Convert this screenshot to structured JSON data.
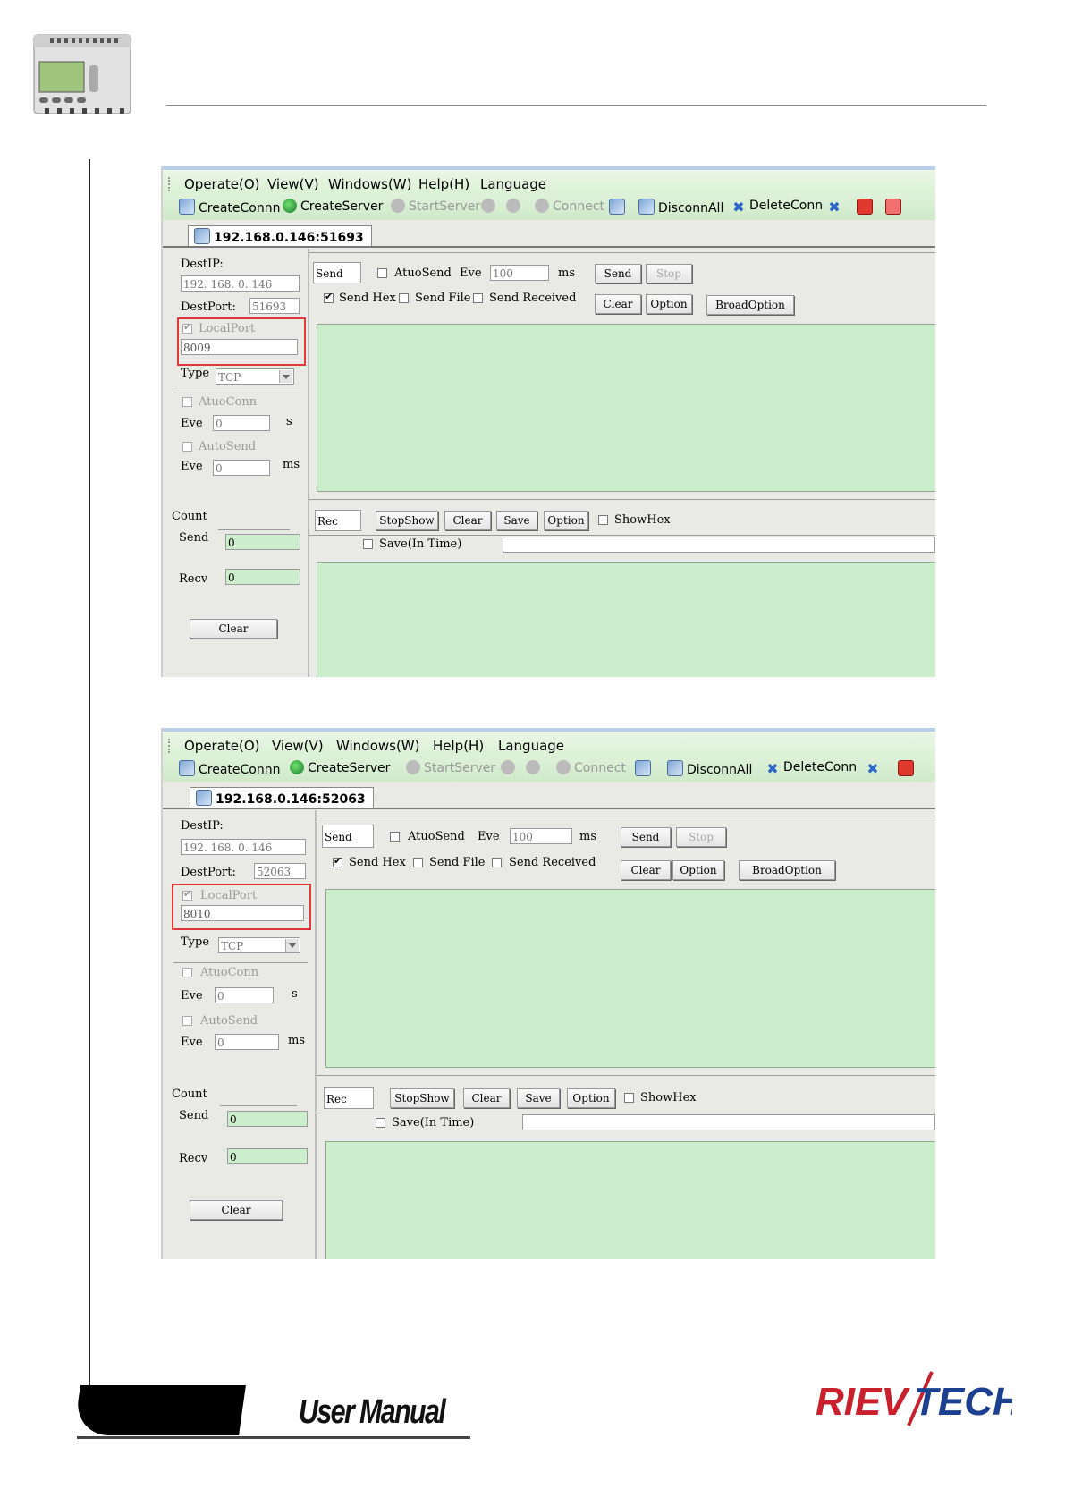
{
  "menu": [
    "Operate(O)",
    "View(V)",
    "Windows(W)",
    "Help(H)",
    "Language"
  ],
  "toolbar": {
    "create_conn": "CreateConnn",
    "create_server": "CreateServer",
    "start_server": "StartServer",
    "connect": "Connect",
    "disconn_all": "DisconnAll",
    "delete_conn": "DeleteConn"
  },
  "labels": {
    "dest_ip": "DestIP:",
    "dest_port": "DestPort:",
    "local_port": "LocalPort",
    "type": "Type",
    "atuo_conn": "AtuoConn",
    "eve": "Eve",
    "s": "s",
    "auto_send": "AutoSend",
    "ms": "ms",
    "count": "Count",
    "send": "Send",
    "recv": "Recv",
    "clear": "Clear"
  },
  "send_panel": {
    "send_label": "Send",
    "atuo_send": "AtuoSend",
    "eve": "Eve",
    "interval": "100",
    "ms": "ms",
    "send_button": "Send",
    "stop_button": "Stop",
    "send_hex": "Send Hex",
    "send_file": "Send File",
    "send_received": "Send Received",
    "clear_button": "Clear",
    "option_button": "Option",
    "broad_option_button": "BroadOption"
  },
  "rec_panel": {
    "rec_label": "Rec",
    "stop_show": "StopShow",
    "clear": "Clear",
    "save": "Save",
    "option": "Option",
    "show_hex": "ShowHex",
    "save_in_time": "Save(In Time)"
  },
  "windows": [
    {
      "tab": "192.168.0.146:51693",
      "dest_ip": "192. 168. 0. 146",
      "dest_port": "51693",
      "local_port": "8009",
      "type": "TCP",
      "eve_s": "0",
      "eve_ms": "0",
      "send_count": "0",
      "recv_count": "0"
    },
    {
      "tab": "192.168.0.146:52063",
      "dest_ip": "192. 168. 0. 146",
      "dest_port": "52063",
      "local_port": "8010",
      "type": "TCP",
      "eve_s": "0",
      "eve_ms": "0",
      "send_count": "0",
      "recv_count": "0"
    }
  ],
  "footer": {
    "user_manual": "User Manual",
    "brand": "RIEVTECH"
  }
}
